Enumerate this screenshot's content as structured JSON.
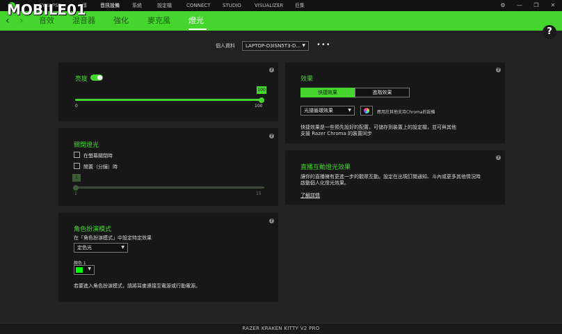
{
  "watermark": "MOBILE01",
  "top_nav": [
    {
      "label": "SYNAPSE"
    },
    {
      "label": "導"
    },
    {
      "label": "音訊設備"
    },
    {
      "label": "系統"
    },
    {
      "label": "設定檔"
    },
    {
      "label": "CONNECT"
    },
    {
      "label": "STUDIO"
    },
    {
      "label": "VISUALIZER"
    },
    {
      "label": "巨集"
    }
  ],
  "window_icons": {
    "settings": "⚙",
    "minimize": "—",
    "restore": "❐",
    "close": "✕"
  },
  "tabs": [
    {
      "label": "音效"
    },
    {
      "label": "混音器"
    },
    {
      "label": "強化"
    },
    {
      "label": "麥克風"
    },
    {
      "label": "燈光",
      "active": true
    }
  ],
  "help_label": "?",
  "profile": {
    "label": "個人資料",
    "value": "LAPTOP-O3ISN5T3-D...",
    "more": "•••"
  },
  "brightness": {
    "title": "亮度",
    "enabled": true,
    "value": 100,
    "value_label": "100",
    "min_label": "0",
    "max_label": "100"
  },
  "lights_off": {
    "title": "關閉燈光",
    "option_screen_off": "在螢幕關閉時",
    "option_idle": "閒置（分鐘）時",
    "slider_value": 1,
    "slider_bubble": "1",
    "min_label": "1",
    "max_label": "15"
  },
  "roleplay": {
    "title": "角色扮演模式",
    "subtitle": "在「角色扮演模式」中設定特定效果",
    "dropdown_value": "定色光",
    "color_label": "顏色 1",
    "color_value": "#00ff00",
    "note": "若要進入角色扮演模式，請將耳麥連接至電源或行動電源。"
  },
  "effects": {
    "title": "效果",
    "tab_quick": "快捷效果",
    "tab_advanced": "進階效果",
    "dropdown_value": "光譜循環效果",
    "chroma_label": "應用於其他支持Chroma的設備",
    "desc_line1": "快捷效果是一些預先設好的配置，可儲存到裝置上的設定檔，並可與其他",
    "desc_line2": "支援 Razer Chroma 的裝置同步"
  },
  "stream": {
    "title": "直播互動燈光效果",
    "desc_line1": "讓你的直播擁有更進一步的觀眾互動。設定在出現訂閱通知、斗內或更多其他情況時",
    "desc_line2": "啟動個人化燈光效果。",
    "link": "了解詳情"
  },
  "footer": "RAZER KRAKEN KITTY V2 PRO",
  "accent_color": "#44d62c"
}
